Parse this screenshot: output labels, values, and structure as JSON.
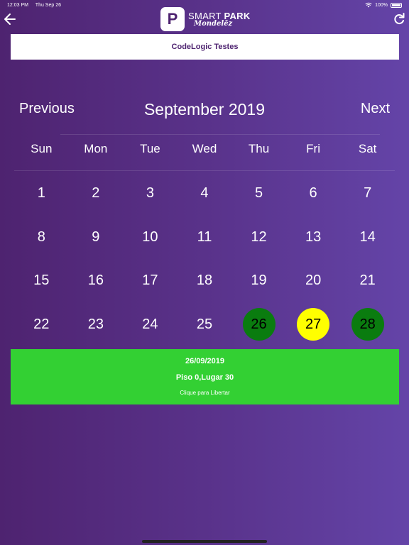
{
  "status_bar": {
    "time": "12:03 PM",
    "date": "Thu Sep 26",
    "battery": "100%"
  },
  "header": {
    "logo_letter": "P",
    "brand_main": "SMART ",
    "brand_bold": "PARK",
    "brand_by": "Mondelēz"
  },
  "user": {
    "name": "CodeLogic Testes"
  },
  "calendar": {
    "previous_label": "Previous",
    "month_title": "September 2019",
    "next_label": "Next",
    "weekdays": [
      "Sun",
      "Mon",
      "Tue",
      "Wed",
      "Thu",
      "Fri",
      "Sat"
    ],
    "weeks": [
      [
        "1",
        "2",
        "3",
        "4",
        "5",
        "6",
        "7"
      ],
      [
        "8",
        "9",
        "10",
        "11",
        "12",
        "13",
        "14"
      ],
      [
        "15",
        "16",
        "17",
        "18",
        "19",
        "20",
        "21"
      ],
      [
        "22",
        "23",
        "24",
        "25",
        "26",
        "27",
        "28"
      ]
    ],
    "today": "27",
    "booked": [
      "26",
      "28"
    ],
    "colors": {
      "booked": "#0a7c0f",
      "today": "#ffff00"
    }
  },
  "reservation": {
    "date": "26/09/2019",
    "place": "Piso 0,Lugar 30",
    "action": "Clique para Libertar",
    "color": "#33d033"
  }
}
